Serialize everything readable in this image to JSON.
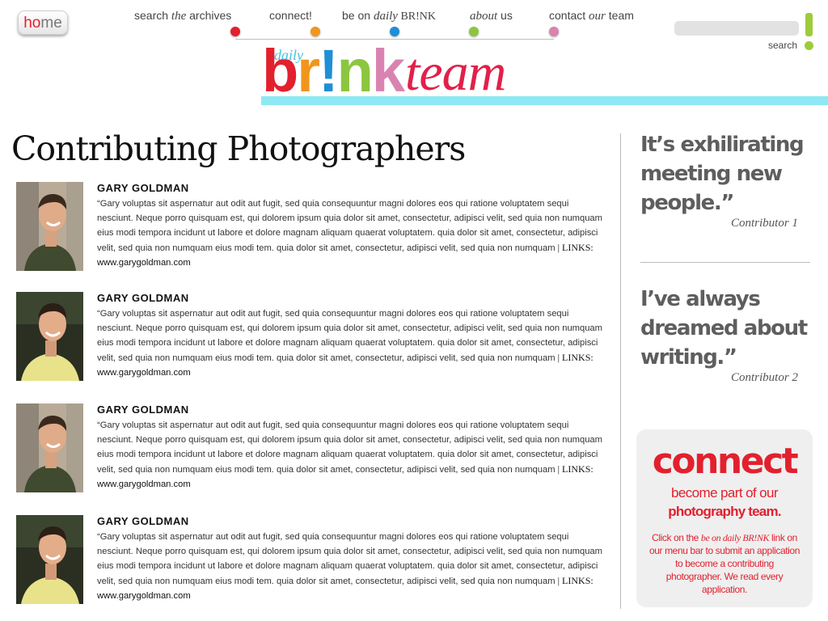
{
  "header": {
    "home_label_1": "h",
    "home_label_2": "o",
    "home_label_3": "m",
    "home_label_4": "e",
    "nav": [
      {
        "pre": "search ",
        "em": "the",
        "post": " archives",
        "color": "#e2202e"
      },
      {
        "pre": "connect!",
        "em": "",
        "post": "",
        "color": "#f0961e"
      },
      {
        "pre": "be on ",
        "em": "daily",
        "post": " BR!NK",
        "color": "#1e8fd6"
      },
      {
        "pre": "",
        "em": "about",
        "post": " us",
        "color": "#8cc63f"
      },
      {
        "pre": "contact ",
        "em": "our",
        "post": " team",
        "color": "#d983b0"
      }
    ],
    "search_placeholder": "",
    "search_label": "search"
  },
  "logo": {
    "daily": "daily",
    "letters": [
      {
        "ch": "b",
        "color": "#e2202e"
      },
      {
        "ch": "r",
        "color": "#f0961e"
      },
      {
        "ch": "!",
        "color": "#1e8fd6"
      },
      {
        "ch": "n",
        "color": "#8cc63f"
      },
      {
        "ch": "k",
        "color": "#d983b0"
      }
    ],
    "team": "team"
  },
  "main": {
    "title": "Contributing Photographers",
    "entries": [
      {
        "name": "GARY GOLDMAN",
        "bio": "“Gary voluptas sit aspernatur aut odit aut fugit, sed quia consequuntur magni dolores eos qui ratione voluptatem sequi nesciunt. Neque porro quisquam est, qui dolorem ipsum quia dolor sit amet, consectetur, adipisci velit, sed quia non numquam eius modi tempora incidunt ut labore et dolore magnam aliquam quaerat voluptatem. quia dolor sit amet, consectetur, adipisci velit, sed quia non numquam eius modi tem. quia dolor sit amet, consectetur, adipisci velit, sed quia non numquam",
        "links_label": "| LINKS:",
        "url": "www.garygoldman.com"
      },
      {
        "name": "GARY GOLDMAN",
        "bio": "“Gary voluptas sit aspernatur aut odit aut fugit, sed quia consequuntur magni dolores eos qui ratione voluptatem sequi nesciunt. Neque porro quisquam est, qui dolorem ipsum quia dolor sit amet, consectetur, adipisci velit, sed quia non numquam eius modi tempora incidunt ut labore et dolore magnam aliquam quaerat voluptatem. quia dolor sit amet, consectetur, adipisci velit, sed quia non numquam eius modi tem. quia dolor sit amet, consectetur, adipisci velit, sed quia non numquam",
        "links_label": "| LINKS:",
        "url": "www.garygoldman.com"
      },
      {
        "name": "GARY GOLDMAN",
        "bio": "“Gary voluptas sit aspernatur aut odit aut fugit, sed quia consequuntur magni dolores eos qui ratione voluptatem sequi nesciunt. Neque porro quisquam est, qui dolorem ipsum quia dolor sit amet, consectetur, adipisci velit, sed quia non numquam eius modi tempora incidunt ut labore et dolore magnam aliquam quaerat voluptatem. quia dolor sit amet, consectetur, adipisci velit, sed quia non numquam eius modi tem. quia dolor sit amet, consectetur, adipisci velit, sed quia non numquam",
        "links_label": "| LINKS:",
        "url": "www.garygoldman.com"
      },
      {
        "name": "GARY GOLDMAN",
        "bio": "“Gary voluptas sit aspernatur aut odit aut fugit, sed quia consequuntur magni dolores eos qui ratione voluptatem sequi nesciunt. Neque porro quisquam est, qui dolorem ipsum quia dolor sit amet, consectetur, adipisci velit, sed quia non numquam eius modi tempora incidunt ut labore et dolore magnam aliquam quaerat voluptatem. quia dolor sit amet, consectetur, adipisci velit, sed quia non numquam eius modi tem. quia dolor sit amet, consectetur, adipisci velit, sed quia non numquam",
        "links_label": "| LINKS:",
        "url": "www.garygoldman.com"
      }
    ]
  },
  "sidebar": {
    "quote1": "It’s exhilirating meeting new people.”",
    "attr1": "Contributor 1",
    "quote2": "I’ve always dreamed about writing.”",
    "attr2": "Contributor 2",
    "connect": {
      "title": "connect",
      "sub1": "become part of our",
      "sub2": "photography team.",
      "body_pre": "Click on the ",
      "body_em": "be on daily BR!NK",
      "body_post": " link on our menu bar to submit an application to become a contributing photographer. We read every application."
    }
  }
}
